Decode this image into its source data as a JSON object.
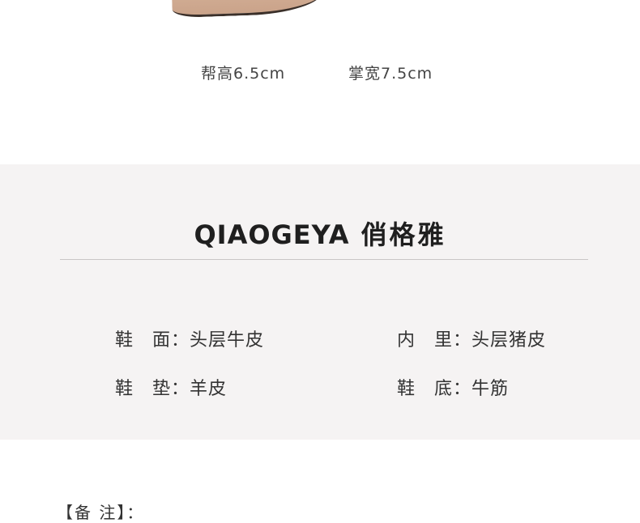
{
  "dimensions": {
    "heel_height": "帮高6.5cm",
    "palm_width": "掌宽7.5cm"
  },
  "brand": {
    "name_en": "QIAOGEYA",
    "name_cn": "俏格雅"
  },
  "specs": [
    {
      "label": "鞋　面：",
      "value": "头层牛皮"
    },
    {
      "label": "内　里：",
      "value": "头层猪皮"
    },
    {
      "label": "鞋　垫：",
      "value": "羊皮"
    },
    {
      "label": "鞋　底：",
      "value": "牛筋"
    }
  ],
  "remark": {
    "label": "【备 注】："
  },
  "colors": {
    "panel_background": "#f5f3f3",
    "divider": "#c9c6c6",
    "text": "#333333"
  }
}
